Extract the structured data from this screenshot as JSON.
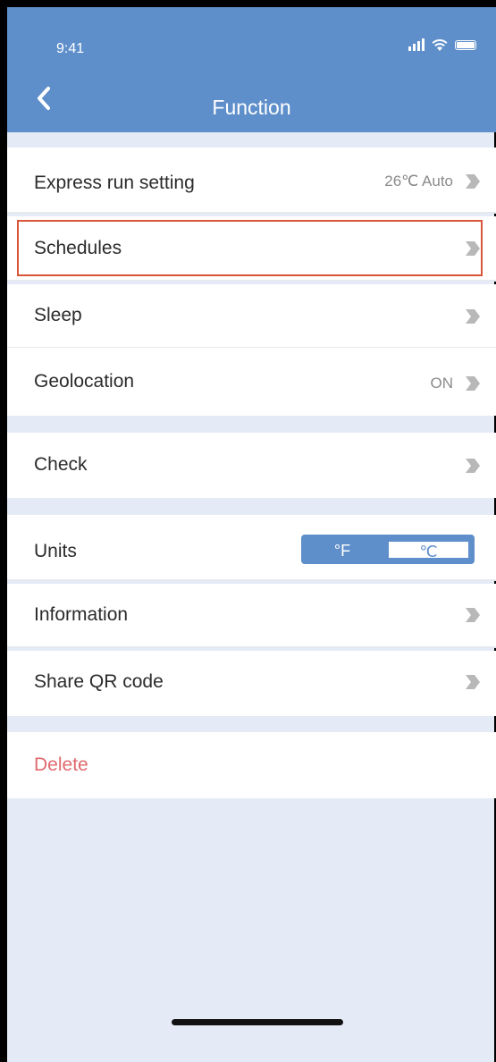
{
  "status_bar": {
    "time": "9:41"
  },
  "header": {
    "title": "Function"
  },
  "rows": {
    "express": {
      "label": "Express run setting",
      "value": "26℃ Auto"
    },
    "schedules": {
      "label": "Schedules"
    },
    "sleep": {
      "label": "Sleep"
    },
    "geolocation": {
      "label": "Geolocation",
      "value": "ON"
    },
    "check": {
      "label": "Check"
    },
    "units": {
      "label": "Units",
      "options": [
        "°F",
        "℃"
      ],
      "selected": "℃"
    },
    "information": {
      "label": "Information"
    },
    "share": {
      "label": "Share QR code"
    },
    "delete": {
      "label": "Delete"
    }
  },
  "colors": {
    "accent": "#5f8fcb",
    "background": "#e4ebf7",
    "delete": "#e06a6e",
    "highlight": "#d9553a"
  },
  "icons": [
    "back-arrow-icon",
    "chevron-right-icon",
    "signal-icon",
    "wifi-icon",
    "battery-icon"
  ]
}
